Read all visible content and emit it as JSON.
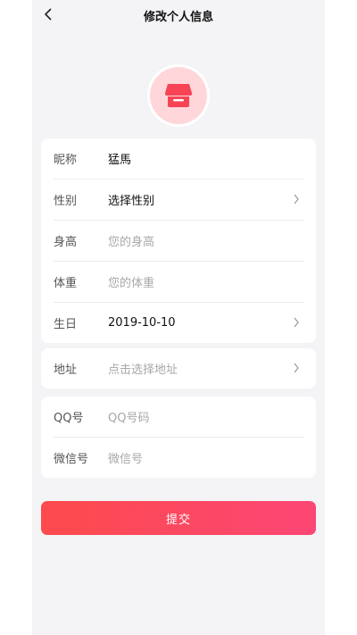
{
  "header": {
    "title": "修改个人信息",
    "back_icon": "chevron-left-icon"
  },
  "avatar": {
    "icon": "store-icon",
    "bg_color": "#ffd6da",
    "icon_color": "#f64455"
  },
  "basic_info": [
    {
      "label": "昵称",
      "value": "猛馬",
      "placeholder": false,
      "chevron": false
    },
    {
      "label": "性别",
      "value": "选择性别",
      "placeholder": false,
      "chevron": true
    },
    {
      "label": "身高",
      "value": "您的身高",
      "placeholder": true,
      "chevron": false
    },
    {
      "label": "体重",
      "value": "您的体重",
      "placeholder": true,
      "chevron": false
    },
    {
      "label": "生日",
      "value": "2019-10-10",
      "placeholder": false,
      "chevron": true
    }
  ],
  "address": {
    "label": "地址",
    "value": "点击选择地址",
    "placeholder": true,
    "chevron": true
  },
  "contact": [
    {
      "label": "QQ号",
      "value": "QQ号码",
      "placeholder": true
    },
    {
      "label": "微信号",
      "value": "微信号",
      "placeholder": true
    }
  ],
  "submit_label": "提交",
  "colors": {
    "accent_start": "#fd4a4c",
    "accent_end": "#fc4775",
    "background": "#f4f4f7"
  }
}
